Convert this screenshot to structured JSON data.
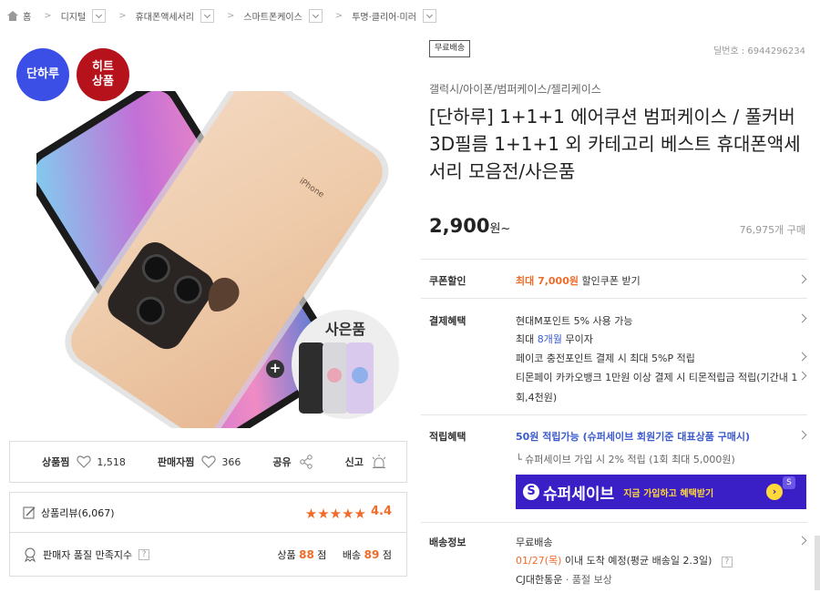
{
  "breadcrumb": {
    "home": "홈",
    "items": [
      "디지털",
      "휴대폰액세서리",
      "스마트폰케이스",
      "투명·클리어·미러"
    ]
  },
  "badges": {
    "one_day": "단하루",
    "hit_line1": "히트",
    "hit_line2": "상품"
  },
  "gift": {
    "title": "사은품",
    "plus": "+"
  },
  "stats": {
    "like_label": "상품찜",
    "like_count": "1,518",
    "seller_like_label": "판매자찜",
    "seller_like_count": "366",
    "share_label": "공유",
    "report_label": "신고"
  },
  "review": {
    "label": "상품리뷰(6,067)",
    "stars": "★★★★★",
    "rating": "4.4"
  },
  "satisfaction": {
    "label": "판매자 품질 만족지수",
    "product_label": "상품",
    "product_score": "88",
    "product_unit": "점",
    "delivery_label": "배송",
    "delivery_score": "89",
    "delivery_unit": "점"
  },
  "product": {
    "free_shipping_tag": "무료배송",
    "deal_number": "딜번호 : 6944296234",
    "category": "갤럭시/아이폰/범퍼케이스/젤리케이스",
    "title": "[단하루] 1+1+1 에어쿠션 범퍼케이스 / 풀커버 3D필름 1+1+1 외 카테고리 베스트 휴대폰액세서리 모음전/사은품",
    "price": "2,900",
    "price_unit": "원~",
    "sold": "76,975개 구매"
  },
  "coupon": {
    "label": "쿠폰할인",
    "highlight": "최대 7,000원",
    "text": "할인쿠폰 받기"
  },
  "payment": {
    "label": "결제혜택",
    "line1": "현대M포인트 5% 사용 가능",
    "line2_pre": "최대 ",
    "line2_hl": "8개월",
    "line2_post": " 무이자",
    "line3": "페이코 충전포인트 결제 시 최대 5%P 적립",
    "line4": "티몬페이 카카오뱅크 1만원 이상 결제 시 티몬적립금 적립(기간내 1",
    "line5": "회,4천원)"
  },
  "points": {
    "label": "적립혜택",
    "headline": "50원 적립가능 (슈퍼세이브 회원기준 대표상품 구매시)",
    "sub": "└ 슈퍼세이브 가입 시 2% 적립 (1회 최대 5,000원)",
    "banner_icon": "S",
    "banner_name": "슈퍼세이브",
    "banner_sub": "지금 가입하고 혜택받기",
    "banner_go": "›",
    "banner_corner": "S"
  },
  "shipping": {
    "label": "배송정보",
    "line1": "무료배송",
    "date": "01/27(목)",
    "line2_post": " 이내 도착 예정(평균 배송일 2.3일)",
    "carrier": "CJ대한통운",
    "carrier_extra": "· 품절 보상"
  },
  "colors": {
    "accent_orange": "#ef6c2a",
    "brand_blue": "#3b4fe6",
    "hit_red": "#b5121b",
    "supersave_purple": "#3a1fc7"
  }
}
